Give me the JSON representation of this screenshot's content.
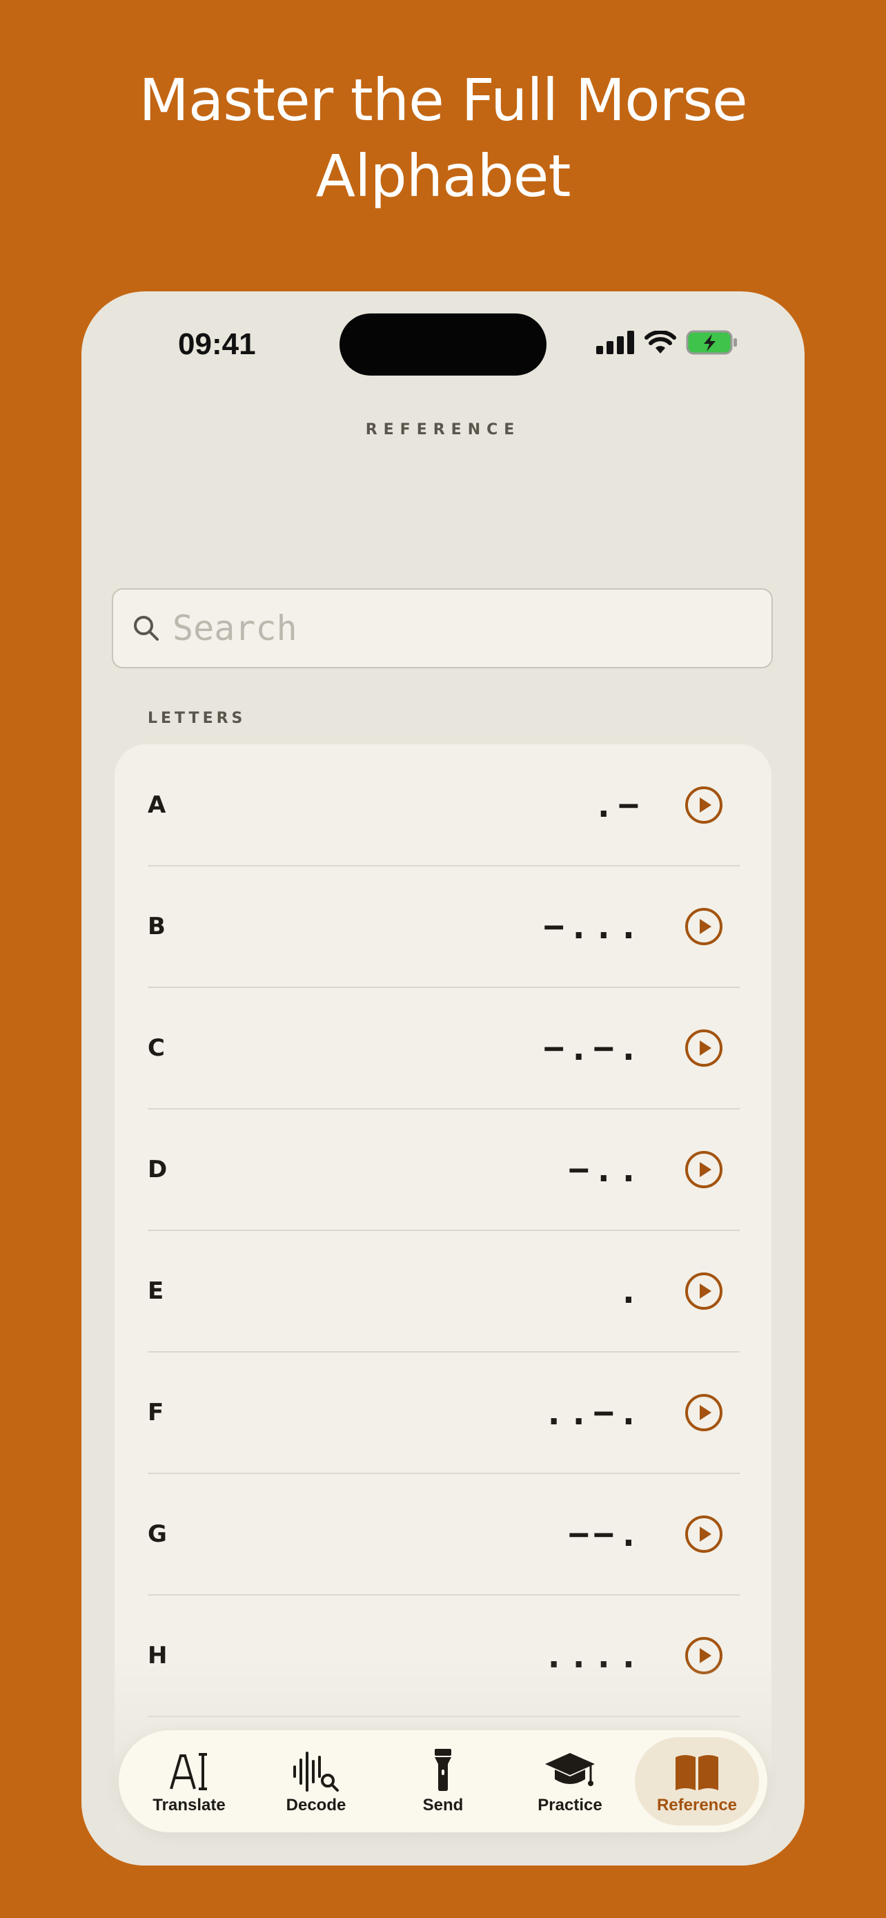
{
  "headline": {
    "line1": "Master the Full Morse",
    "line2": "Alphabet"
  },
  "status_bar": {
    "time": "09:41"
  },
  "screen_title": "REFERENCE",
  "search": {
    "placeholder": "Search",
    "value": ""
  },
  "section_label": "LETTERS",
  "letters": [
    {
      "letter": "A",
      "code": ".−"
    },
    {
      "letter": "B",
      "code": "−..."
    },
    {
      "letter": "C",
      "code": "−.−."
    },
    {
      "letter": "D",
      "code": "−.."
    },
    {
      "letter": "E",
      "code": "."
    },
    {
      "letter": "F",
      "code": "..−."
    },
    {
      "letter": "G",
      "code": "−−."
    },
    {
      "letter": "H",
      "code": "...."
    }
  ],
  "tabs": [
    {
      "label": "Translate",
      "icon": "text-cursor-icon",
      "active": false
    },
    {
      "label": "Decode",
      "icon": "waveform-search-icon",
      "active": false
    },
    {
      "label": "Send",
      "icon": "flashlight-icon",
      "active": false
    },
    {
      "label": "Practice",
      "icon": "graduation-cap-icon",
      "active": false
    },
    {
      "label": "Reference",
      "icon": "book-icon",
      "active": true
    }
  ],
  "colors": {
    "background": "#C36613",
    "phone": "#E8E5DC",
    "card": "#F2F0E8",
    "accent": "#A3530F",
    "battery": "#3FC34A"
  }
}
